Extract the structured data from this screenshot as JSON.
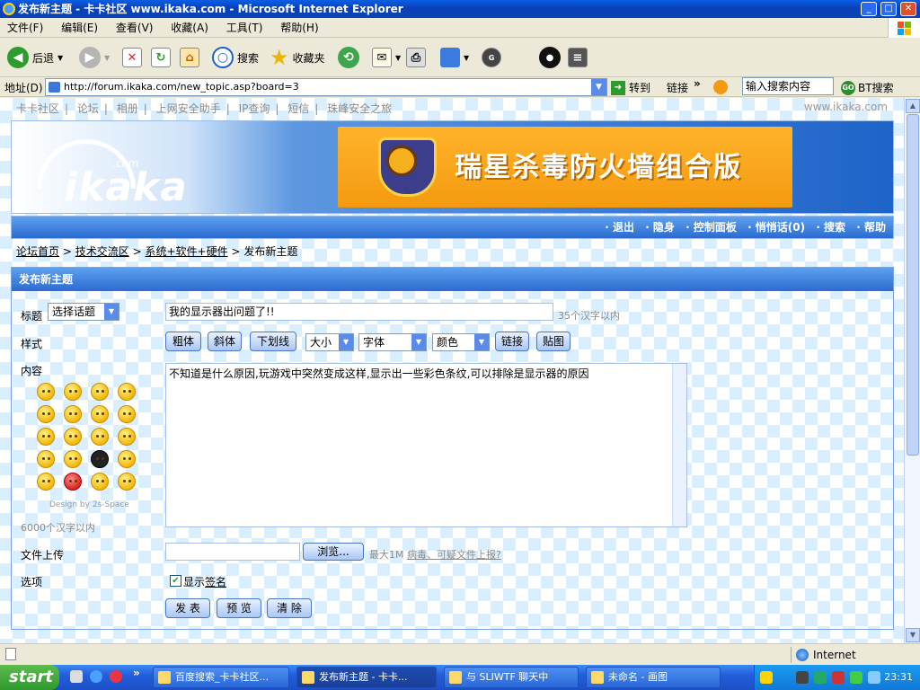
{
  "window": {
    "title": "发布新主题 - 卡卡社区 www.ikaka.com - Microsoft Internet Explorer",
    "min": "_",
    "max": "□",
    "close": "✕"
  },
  "menu": [
    "文件(F)",
    "编辑(E)",
    "查看(V)",
    "收藏(A)",
    "工具(T)",
    "帮助(H)"
  ],
  "toolbar": {
    "back": "后退",
    "search": "搜索",
    "favorites": "收藏夹"
  },
  "address": {
    "label": "地址(D)",
    "url": "http://forum.ikaka.com/new_topic.asp?board=3",
    "go": "转到",
    "links": "链接",
    "search_box": "输入搜索内容",
    "bt_search": "BT搜索"
  },
  "site": {
    "toplinks": [
      "卡卡社区",
      "|",
      "论坛",
      "|",
      "相册",
      "|",
      "上网安全助手",
      "|",
      "IP查询",
      "|",
      "短信",
      "|",
      "珠峰安全之旅"
    ],
    "www": "www.ikaka.com",
    "logo_text": "ikaka",
    "logo_com": ".com",
    "ad_text": "瑞星杀毒防火墙组合版",
    "nav": [
      "· 退出",
      "· 隐身",
      "· 控制面板",
      "· 悄悄话(0)",
      "· 搜索",
      "· 帮助"
    ]
  },
  "breadcrumb": [
    "论坛首页",
    ">",
    "技术交流区",
    ">",
    "系统+软件+硬件",
    ">",
    "发布新主题"
  ],
  "form": {
    "header": "发布新主题",
    "title_label": "标题",
    "topic_select": "选择话题",
    "title_value": "我的显示器出问题了!!",
    "title_hint": "35个汉字以内",
    "style_label": "样式",
    "style_buttons": [
      "粗体",
      "斜体",
      "下划线"
    ],
    "size_select": "大小",
    "font_select": "字体",
    "color_select": "颜色",
    "link_button": "链接",
    "image_button": "贴图",
    "content_label": "内容",
    "content_value": "不知道是什么原因,玩游戏中突然变成这样,显示出一些彩色条纹,可以排除是显示器的原因",
    "design_credit": "Design by 2s-Space",
    "content_hint": "6000个汉字以内",
    "upload_label": "文件上传",
    "browse": "浏览...",
    "upload_hint": "最大1M",
    "upload_link": "病毒、可疑文件上报?",
    "options_label": "选项",
    "show_sig": "显示",
    "sig_link": "签名",
    "submit": "发 表",
    "preview": "预 览",
    "clear": "清 除"
  },
  "status": {
    "zone": "Internet"
  },
  "taskbar": {
    "start": "start",
    "tasks": [
      "百度搜索_卡卡社区...",
      "发布新主题 - 卡卡...",
      "与 SLIWTF 聊天中",
      "未命名 - 画图"
    ],
    "clock": "23:31"
  }
}
